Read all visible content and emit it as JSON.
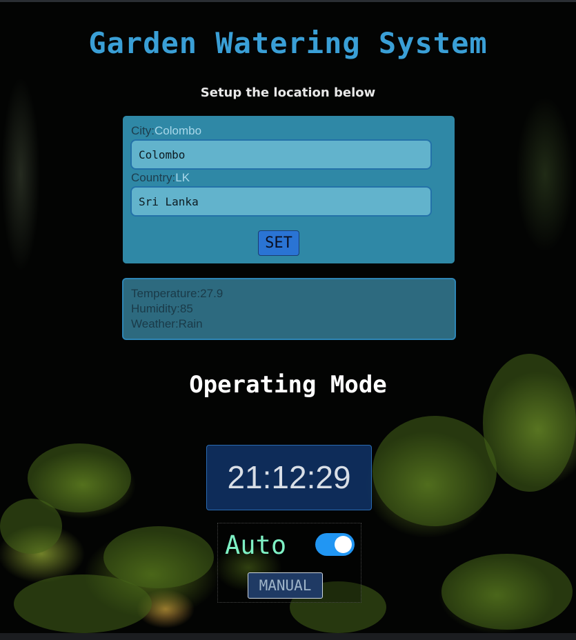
{
  "header": {
    "title": "Garden Watering System",
    "subtitle": "Setup the location below"
  },
  "location": {
    "city_label": "City:",
    "city_display": "Colombo",
    "city_value": "Colombo",
    "country_label": "Country:",
    "country_display": "LK",
    "country_value": "Sri Lanka",
    "set_label": "SET"
  },
  "weather": {
    "temperature_label": "Temperature:",
    "temperature": "27.9",
    "humidity_label": "Humidity:",
    "humidity": "85",
    "weather_label": "Weather:",
    "weather": "Rain"
  },
  "mode": {
    "title": "Operating Mode",
    "clock": "21:12:29",
    "auto_label": "Auto",
    "auto_enabled": true,
    "manual_label": "MANUAL"
  },
  "colors": {
    "title": "#3a9fd6",
    "card": "#2f88a6",
    "toggle_on": "#2196f3",
    "auto_text": "#7ef0c4"
  }
}
